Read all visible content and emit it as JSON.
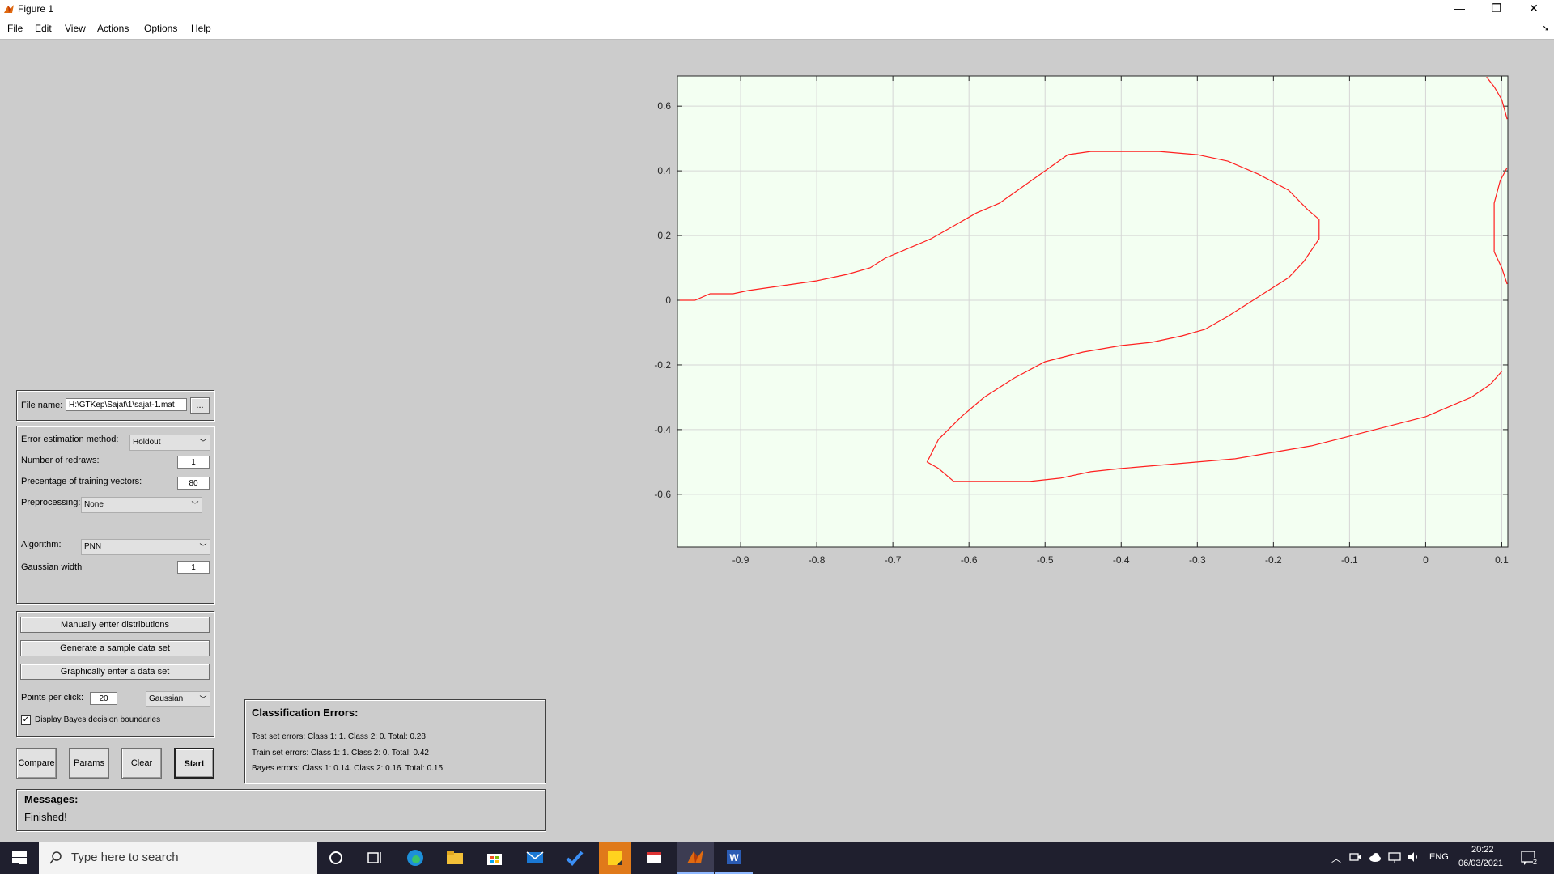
{
  "window": {
    "title": "Figure 1",
    "minimize": "—",
    "restore": "❐",
    "close": "✕"
  },
  "menu": {
    "items": [
      "File",
      "Edit",
      "View",
      "Actions",
      "Options",
      "Help"
    ]
  },
  "file_panel": {
    "label": "File name:",
    "value": "H:\\GTKep\\Sajat\\1\\sajat-1.mat",
    "browse": "..."
  },
  "params_panel": {
    "error_method_label": "Error estimation method:",
    "error_method_value": "Holdout",
    "redraws_label": "Number of redraws:",
    "redraws_value": "1",
    "training_label": "Precentage of training vectors:",
    "training_value": "80",
    "preprocessing_label": "Preprocessing:",
    "preprocessing_value": "None",
    "algorithm_label": "Algorithm:",
    "algorithm_value": "PNN",
    "gaussian_label": "Gaussian width",
    "gaussian_value": "1"
  },
  "data_panel": {
    "manual_button": "Manually enter distributions",
    "generate_button": "Generate a sample data set",
    "graphical_button": "Graphically enter a data set",
    "points_label": "Points per click:",
    "points_value": "20",
    "distribution_value": "Gaussian",
    "bayes_checkbox_label": "Display Bayes decision boundaries",
    "bayes_checked": true
  },
  "buttons": {
    "compare": "Compare",
    "params": "Params",
    "clear": "Clear",
    "start": "Start"
  },
  "classification": {
    "title": "Classification Errors:",
    "test": "Test set errors: Class 1: 1. Class 2: 0. Total: 0.28",
    "train": "Train set errors: Class 1: 1. Class 2: 0. Total: 0.42",
    "bayes": "Bayes errors: Class 1: 0.14. Class 2: 0.16. Total: 0.15"
  },
  "messages": {
    "title": "Messages:",
    "text": "Finished!"
  },
  "chart_data": {
    "type": "line",
    "title": "",
    "xlabel": "",
    "ylabel": "",
    "xlim": [
      -0.983,
      0.108
    ],
    "ylim": [
      -0.763,
      0.693
    ],
    "xticks": [
      -0.9,
      -0.8,
      -0.7,
      -0.6,
      -0.5,
      -0.4,
      -0.3,
      -0.2,
      -0.1,
      0,
      0.1
    ],
    "yticks": [
      -0.6,
      -0.4,
      -0.2,
      0,
      0.2,
      0.4,
      0.6
    ],
    "grid": true,
    "background": "#f3fff2",
    "line_color": "#ff2020",
    "series": [
      {
        "values": [
          [
            -0.98,
            0.0
          ],
          [
            -0.96,
            0.0
          ],
          [
            -0.94,
            0.02
          ],
          [
            -0.91,
            0.02
          ],
          [
            -0.89,
            0.03
          ],
          [
            -0.86,
            0.04
          ],
          [
            -0.83,
            0.05
          ],
          [
            -0.8,
            0.06
          ],
          [
            -0.78,
            0.07
          ],
          [
            -0.76,
            0.08
          ],
          [
            -0.73,
            0.1
          ],
          [
            -0.71,
            0.13
          ],
          [
            -0.68,
            0.16
          ],
          [
            -0.65,
            0.19
          ],
          [
            -0.62,
            0.23
          ],
          [
            -0.59,
            0.27
          ],
          [
            -0.56,
            0.3
          ],
          [
            -0.53,
            0.35
          ],
          [
            -0.5,
            0.4
          ],
          [
            -0.47,
            0.45
          ],
          [
            -0.44,
            0.46
          ],
          [
            -0.4,
            0.46
          ],
          [
            -0.35,
            0.46
          ],
          [
            -0.3,
            0.45
          ],
          [
            -0.26,
            0.43
          ],
          [
            -0.22,
            0.39
          ],
          [
            -0.18,
            0.34
          ],
          [
            -0.155,
            0.28
          ],
          [
            -0.14,
            0.25
          ],
          [
            -0.14,
            0.19
          ],
          [
            -0.16,
            0.12
          ],
          [
            -0.18,
            0.07
          ],
          [
            -0.22,
            0.01
          ],
          [
            -0.26,
            -0.05
          ],
          [
            -0.29,
            -0.09
          ],
          [
            -0.32,
            -0.11
          ],
          [
            -0.36,
            -0.13
          ],
          [
            -0.4,
            -0.14
          ],
          [
            -0.45,
            -0.16
          ],
          [
            -0.5,
            -0.19
          ],
          [
            -0.54,
            -0.24
          ],
          [
            -0.58,
            -0.3
          ],
          [
            -0.61,
            -0.36
          ],
          [
            -0.64,
            -0.43
          ],
          [
            -0.655,
            -0.5
          ],
          [
            -0.64,
            -0.52
          ],
          [
            -0.62,
            -0.56
          ],
          [
            -0.58,
            -0.56
          ],
          [
            -0.52,
            -0.56
          ],
          [
            -0.48,
            -0.55
          ],
          [
            -0.44,
            -0.53
          ],
          [
            -0.4,
            -0.52
          ],
          [
            -0.35,
            -0.51
          ],
          [
            -0.3,
            -0.5
          ],
          [
            -0.25,
            -0.49
          ],
          [
            -0.2,
            -0.47
          ],
          [
            -0.15,
            -0.45
          ],
          [
            -0.1,
            -0.42
          ],
          [
            -0.05,
            -0.39
          ],
          [
            0.0,
            -0.36
          ],
          [
            0.03,
            -0.33
          ],
          [
            0.06,
            -0.3
          ],
          [
            0.085,
            -0.26
          ],
          [
            0.1,
            -0.22
          ]
        ]
      },
      {
        "values": [
          [
            0.08,
            0.69
          ],
          [
            0.09,
            0.66
          ],
          [
            0.1,
            0.62
          ],
          [
            0.107,
            0.56
          ]
        ]
      },
      {
        "values": [
          [
            0.107,
            0.41
          ],
          [
            0.098,
            0.37
          ],
          [
            0.09,
            0.3
          ],
          [
            0.09,
            0.15
          ],
          [
            0.1,
            0.1
          ],
          [
            0.107,
            0.05
          ]
        ]
      }
    ]
  },
  "taskbar": {
    "search_placeholder": "Type here to search",
    "language": "ENG",
    "time": "20:22",
    "date": "06/03/2021",
    "notification_count": "2"
  }
}
